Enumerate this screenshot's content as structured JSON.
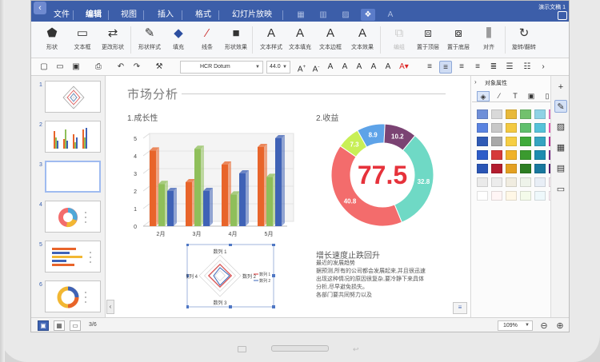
{
  "menu": {
    "items": [
      "文件",
      "编辑",
      "视图",
      "插入",
      "格式",
      "幻灯片放映"
    ],
    "doc_name": "演示文稿 1"
  },
  "ribbon": [
    {
      "label": "形状",
      "icon": "shape-icon",
      "glyph": "⬟"
    },
    {
      "label": "文本框",
      "icon": "textbox-icon",
      "glyph": "▭"
    },
    {
      "label": "更改形状",
      "icon": "change-shape-icon",
      "glyph": "⇄"
    },
    {
      "label": "形状样式",
      "icon": "shape-style-icon",
      "glyph": "✎"
    },
    {
      "label": "填充",
      "icon": "fill-icon",
      "glyph": "◆"
    },
    {
      "label": "线条",
      "icon": "line-icon",
      "glyph": "⁄"
    },
    {
      "label": "形状效果",
      "icon": "shape-effect-icon",
      "glyph": "■"
    },
    {
      "label": "文本样式",
      "icon": "text-style-icon",
      "glyph": "A"
    },
    {
      "label": "文本填充",
      "icon": "text-fill-icon",
      "glyph": "A"
    },
    {
      "label": "文本边框",
      "icon": "text-border-icon",
      "glyph": "A"
    },
    {
      "label": "文本效果",
      "icon": "text-effect-icon",
      "glyph": "A"
    },
    {
      "label": "编组",
      "icon": "group-icon",
      "glyph": "⧉"
    },
    {
      "label": "置于顶层",
      "icon": "bring-front-icon",
      "glyph": "⧈"
    },
    {
      "label": "置于底层",
      "icon": "send-back-icon",
      "glyph": "⧇"
    },
    {
      "label": "对齐",
      "icon": "align-icon",
      "glyph": "⫼"
    },
    {
      "label": "旋转/翻转",
      "icon": "rotate-icon",
      "glyph": "↻"
    }
  ],
  "format": {
    "font": "HCR Dotum",
    "size": "44.0"
  },
  "slides": [
    {
      "num": "1"
    },
    {
      "num": "2"
    },
    {
      "num": "3"
    },
    {
      "num": "4"
    },
    {
      "num": "5"
    },
    {
      "num": "6"
    }
  ],
  "slide": {
    "title": "市场分析",
    "growth_title": "1.成长性",
    "revenue_title": "2.收益",
    "headline": "增长速度止跌回升",
    "body": [
      "最近的发展趋势",
      "据预测,所有的公司都会发展起来,并且很迅速",
      "出现这种情况的原因很复杂,要冷静下来具体",
      "分析,尽早避免损失。",
      "各部门要共同努力以及"
    ]
  },
  "chart_data": [
    {
      "type": "bar",
      "categories": [
        "2月",
        "3月",
        "4月",
        "5月"
      ],
      "ylim": [
        0,
        5
      ],
      "yticks": [
        "0",
        "1",
        "2",
        "3",
        "4",
        "5"
      ],
      "series": [
        {
          "values": [
            4.3,
            2.5,
            3.5,
            4.5
          ],
          "color": "#e8642a"
        },
        {
          "values": [
            2.4,
            4.4,
            1.8,
            2.8
          ],
          "color": "#8fbf5a"
        },
        {
          "values": [
            2.0,
            2.0,
            3.0,
            5.0
          ],
          "color": "#3f62b6"
        }
      ]
    },
    {
      "type": "pie",
      "values": [
        77.5,
        32.8,
        40.8,
        7.3,
        8.9,
        10.2
      ],
      "labels": [
        "77.5",
        "32.8",
        "40.8",
        "7.3",
        "8.9",
        "10.2"
      ],
      "colors": [
        "#ffffff",
        "#6fd9c5",
        "#f36c6c",
        "#c8ef57",
        "#5ea3e8",
        "#7b4373"
      ]
    },
    {
      "type": "radar",
      "axes": [
        "数列 1",
        "数列 2",
        "数列 3",
        "数列 4"
      ],
      "legend": [
        "数列 1",
        "数列 2"
      ]
    }
  ],
  "props_title": "对象属性",
  "swatch_colors": [
    [
      "#6f8fd8",
      "#d9d9d9",
      "#e8b93a",
      "#72c16d",
      "#8fd2e5",
      "#e77bc8"
    ],
    [
      "#5a83e0",
      "#c8c8c8",
      "#f3c941",
      "#5fbf6d",
      "#56c2d9",
      "#f05fbe"
    ],
    [
      "#2f5ab5",
      "#a8a8a8",
      "#f6ce43",
      "#3faa3b",
      "#36a4c1",
      "#c0389c"
    ],
    [
      "#2d5cc9",
      "#d63a3a",
      "#f0b229",
      "#3b9a2f",
      "#1e8cb0",
      "#7f2f8f"
    ],
    [
      "#2a55b5",
      "#b31d2f",
      "#e3a022",
      "#2d7e23",
      "#19789e",
      "#5d2377"
    ],
    [
      "#eaeaea",
      "#ececec",
      "#f0ece0",
      "#eef3ea",
      "#e8eef6",
      "#f5e7ef"
    ],
    [
      "#ffffff",
      "#fff5f5",
      "#fff7e6",
      "#f4fbea",
      "#eef8fb",
      "#fbf0f7"
    ]
  ],
  "status": {
    "page": "3/6",
    "zoom": "109%"
  }
}
